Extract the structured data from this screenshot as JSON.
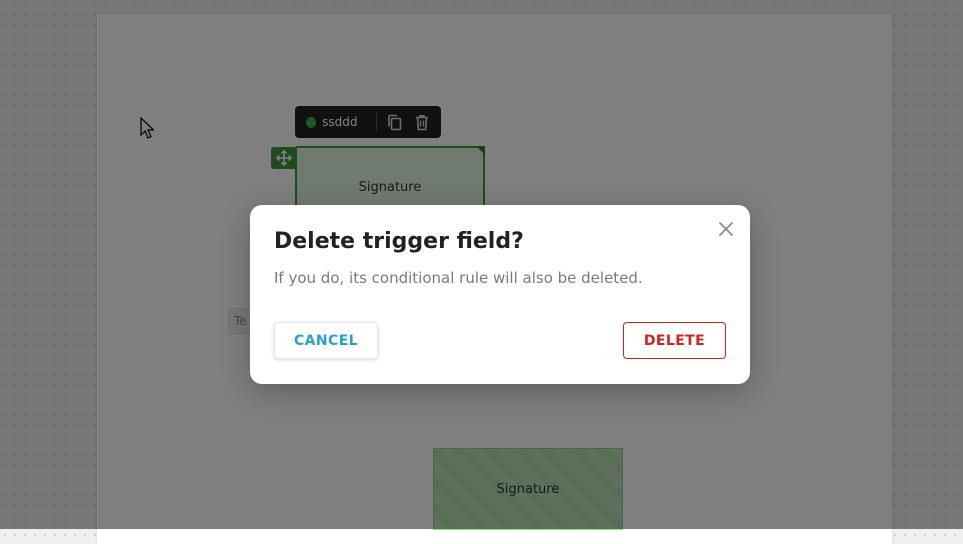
{
  "field_toolbar": {
    "label": "ssddd",
    "status_color": "#3bb04a",
    "icons": [
      "copy-icon",
      "trash-icon"
    ]
  },
  "fields": {
    "signature_top_label": "Signature",
    "signature_bottom_label": "Signature",
    "text_field_label": "Te"
  },
  "colors": {
    "field_green": "#3a9a3f",
    "cancel_blue": "#2a9fd6",
    "delete_red": "#d42020"
  },
  "dialog": {
    "title": "Delete trigger field?",
    "message": "If you do, its conditional rule will also be deleted.",
    "cancel_label": "CANCEL",
    "delete_label": "DELETE",
    "close_icon": "close-icon"
  }
}
